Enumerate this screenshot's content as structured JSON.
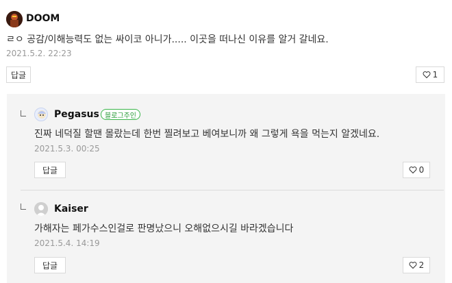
{
  "comments": [
    {
      "author": "DOOM",
      "text": "ㄹㅇ 공감/이해능력도 없는 싸이코 아니가..... 이곳을 떠나신 이유를 알거 갈네요.",
      "date": "2021.5.2. 22:23",
      "reply_label": "답글",
      "likes": "1"
    }
  ],
  "replies": [
    {
      "author": "Pegasus",
      "badge": "블로그주인",
      "text": "진짜 네덕질 할땐 몰랐는데 한번 찔려보고 베여보니까 왜 그렇게 욕을 먹는지 알겠네요.",
      "date": "2021.5.3. 00:25",
      "reply_label": "답글",
      "likes": "0"
    },
    {
      "author": "Kaiser",
      "text": "가해자는 페가수스인걸로 판명났으니 오해없으시길 바라겠습니다",
      "date": "2021.5.4. 14:19",
      "reply_label": "답글",
      "likes": "2"
    }
  ],
  "colors": {
    "badge_green": "#3ab54a",
    "reply_background": "#f4f4f4"
  },
  "icons": [
    "heart-icon",
    "reply-elbow-icon",
    "avatar"
  ]
}
